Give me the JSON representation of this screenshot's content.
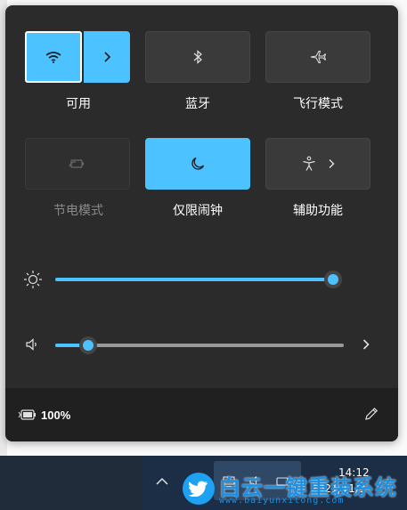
{
  "quick_settings": {
    "tiles": {
      "wifi": {
        "label": "可用",
        "state": "on"
      },
      "bluetooth": {
        "label": "蓝牙",
        "state": "off"
      },
      "airplane": {
        "label": "飞行模式",
        "state": "off"
      },
      "battery_saver": {
        "label": "节电模式",
        "state": "disabled"
      },
      "focus_assist": {
        "label": "仅限闹钟",
        "state": "on"
      },
      "accessibility": {
        "label": "辅助功能",
        "state": "off"
      }
    },
    "brightness": {
      "icon": "sun-icon",
      "level": 1.0
    },
    "volume": {
      "icon": "speaker-icon",
      "level": 0.1
    },
    "footer": {
      "battery_percent": "100%",
      "battery_icon": "battery-charging-icon",
      "edit_icon": "pencil-icon"
    }
  },
  "taskbar": {
    "time": "14:12",
    "date": "2021/11/3"
  },
  "watermark": {
    "text": "白云一键重装系统",
    "url": "www.baiyunxitong.com"
  },
  "colors": {
    "accent": "#4cc2ff",
    "panel": "#2b2b2b",
    "footer": "#202020"
  }
}
